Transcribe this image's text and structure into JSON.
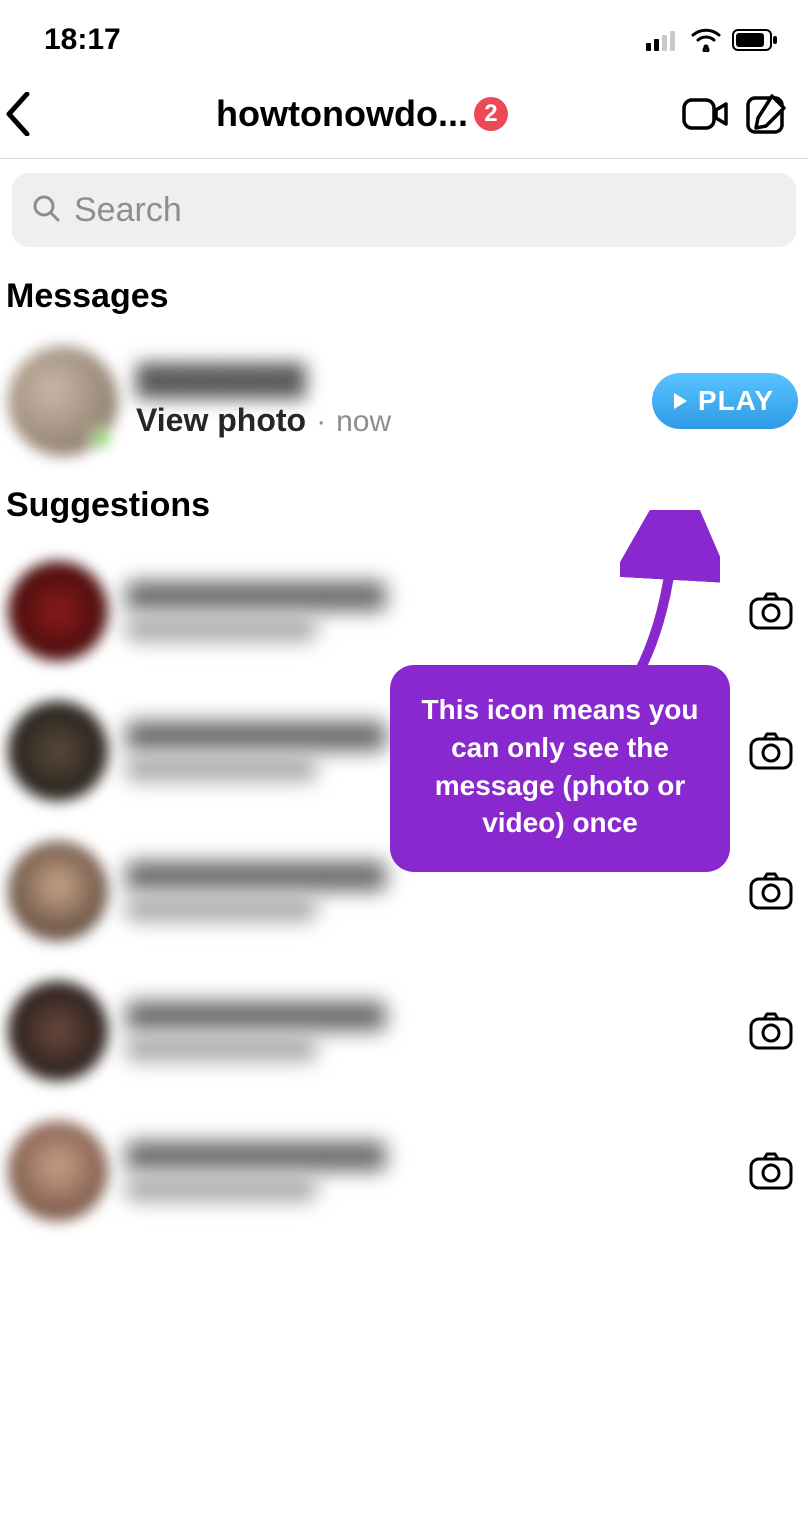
{
  "status": {
    "time": "18:17"
  },
  "header": {
    "username": "howtonowdo...",
    "badge": "2"
  },
  "search": {
    "placeholder": "Search"
  },
  "sections": {
    "messages_title": "Messages",
    "suggestions_title": "Suggestions"
  },
  "message": {
    "action": "View photo",
    "separator": "·",
    "time": "now",
    "play_label": "PLAY"
  },
  "callout": {
    "text": "This icon means you can only see the message (photo or video) once"
  },
  "suggestions": [
    {},
    {},
    {},
    {},
    {}
  ]
}
